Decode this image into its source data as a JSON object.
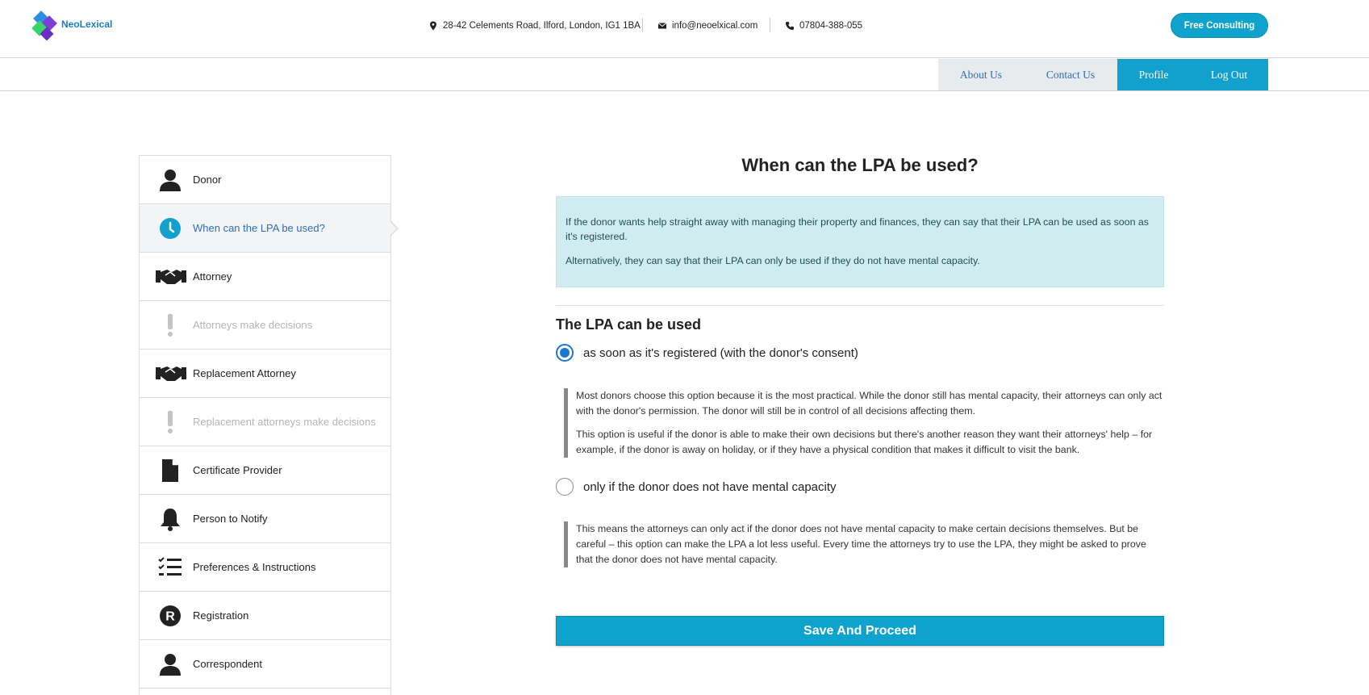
{
  "header": {
    "logo_text": "NeoLexical",
    "address": "28-42 Celements Road, Ilford, London, IG1 1BA",
    "email": "info@neoelxical.com",
    "phone": "07804-388-055",
    "consult_label": "Free Consulting"
  },
  "nav": {
    "about": "About Us",
    "contact": "Contact Us",
    "profile": "Profile",
    "logout": "Log Out"
  },
  "sidebar": {
    "items": [
      {
        "label": "Donor",
        "icon": "person-icon",
        "state": "normal"
      },
      {
        "label": "When can the LPA be used?",
        "icon": "clock-icon",
        "state": "active"
      },
      {
        "label": "Attorney",
        "icon": "handshake-icon",
        "state": "normal"
      },
      {
        "label": "Attorneys make decisions",
        "icon": "exclamation-icon",
        "state": "disabled"
      },
      {
        "label": "Replacement Attorney",
        "icon": "handshake-icon",
        "state": "normal"
      },
      {
        "label": "Replacement attorneys make decisions",
        "icon": "exclamation-icon",
        "state": "disabled"
      },
      {
        "label": "Certificate Provider",
        "icon": "document-icon",
        "state": "normal"
      },
      {
        "label": "Person to Notify",
        "icon": "bell-icon",
        "state": "normal"
      },
      {
        "label": "Preferences & Instructions",
        "icon": "checklist-icon",
        "state": "normal"
      },
      {
        "label": "Registration",
        "icon": "registered-icon",
        "state": "normal"
      },
      {
        "label": "Correspondent",
        "icon": "person-icon",
        "state": "normal"
      }
    ]
  },
  "main": {
    "title": "When can the LPA be used?",
    "info_p1": "If the donor wants help straight away with managing their property and finances, they can say that their LPA can be used as soon as it's registered.",
    "info_p2": "Alternatively, they can say that their LPA can only be used if they do not have mental capacity.",
    "subtitle": "The LPA can be used",
    "option1_label": "as soon as it's registered (with the donor's consent)",
    "option1_checked": true,
    "option1_p1": "Most donors choose this option because it is the most practical. While the donor still has mental capacity, their attorneys can only act with the donor's permission. The donor will still be in control of all decisions affecting them.",
    "option1_p2": "This option is useful if the donor is able to make their own decisions but there's another reason they want their attorneys' help – for example, if the donor is away on holiday, or if they have a physical condition that makes it difficult to visit the bank.",
    "option2_label": "only if the donor does not have mental capacity",
    "option2_checked": false,
    "option2_p1": "This means the attorneys can only act if the donor does not have mental capacity to make certain decisions themselves. But be careful – this option can make the LPA a lot less useful. Every time the attorneys try to use the LPA, they might be asked to prove that the donor does not have mental capacity.",
    "save_label": "Save And Proceed"
  },
  "colors": {
    "accent": "#0ea3cc",
    "link": "#2f6fb2",
    "info_bg": "#d1ecf1",
    "radio": "#1976d2"
  }
}
